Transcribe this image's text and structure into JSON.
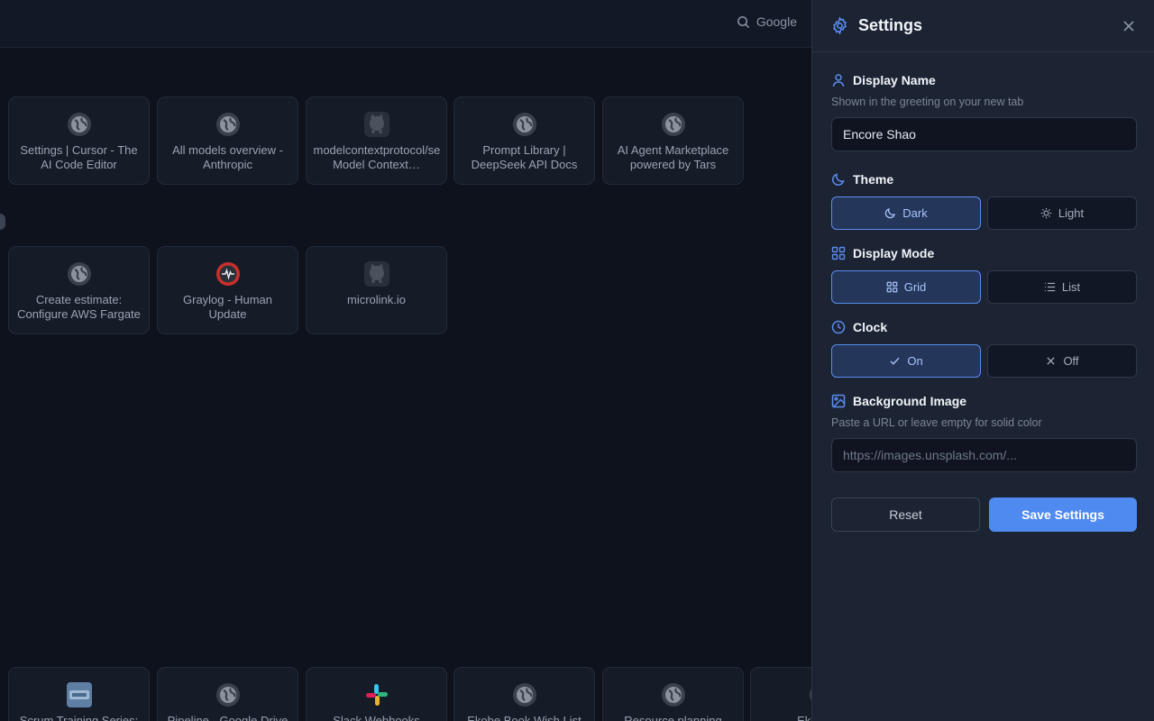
{
  "topbar": {
    "search_label": "Google"
  },
  "tiles_row1": [
    {
      "label": "Settings | Cursor - The AI Code Editor",
      "icon": "globe-icon"
    },
    {
      "label": "All models overview - Anthropic",
      "icon": "globe-icon"
    },
    {
      "label": "modelcontextprotocol/servers: Model Context…",
      "icon": "github-icon"
    },
    {
      "label": "Prompt Library | DeepSeek API Docs",
      "icon": "globe-icon"
    },
    {
      "label": "AI Agent Marketplace powered by Tars",
      "icon": "globe-icon"
    }
  ],
  "tiles_row2": [
    {
      "label": "Create estimate: Configure AWS Fargate",
      "icon": "globe-icon"
    },
    {
      "label": "Graylog - Human Update",
      "icon": "graylog-icon"
    },
    {
      "label": "microlink.io",
      "icon": "github-icon"
    }
  ],
  "tiles_row3": [
    {
      "label": "Scrum Training Series:",
      "icon": "image-thumb-icon"
    },
    {
      "label": "Pipeline - Google Drive",
      "icon": "globe-icon"
    },
    {
      "label": "Slack Webhooks",
      "icon": "slack-icon"
    },
    {
      "label": "Ekobe Book Wish List",
      "icon": "globe-icon"
    },
    {
      "label": "Resource planning",
      "icon": "globe-icon"
    },
    {
      "label": "Ekobe W",
      "icon": "globe-icon"
    }
  ],
  "settings": {
    "title": "Settings",
    "display_name": {
      "label": "Display Name",
      "hint": "Shown in the greeting on your new tab",
      "value": "Encore Shao"
    },
    "theme": {
      "label": "Theme",
      "options": [
        "Dark",
        "Light"
      ],
      "selected": "Dark"
    },
    "display_mode": {
      "label": "Display Mode",
      "options": [
        "Grid",
        "List"
      ],
      "selected": "Grid"
    },
    "clock": {
      "label": "Clock",
      "options": [
        "On",
        "Off"
      ],
      "selected": "On"
    },
    "background_image": {
      "label": "Background Image",
      "hint": "Paste a URL or leave empty for solid color",
      "placeholder": "https://images.unsplash.com/..."
    },
    "reset_label": "Reset",
    "save_label": "Save Settings"
  },
  "colors": {
    "accent": "#4f8af0",
    "panel_bg": "#1c2333",
    "page_bg": "#0d121d"
  }
}
